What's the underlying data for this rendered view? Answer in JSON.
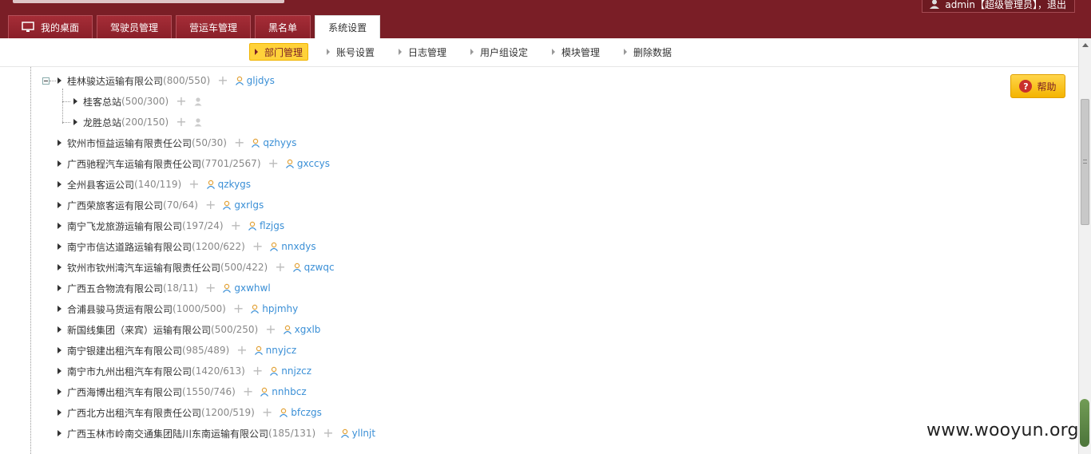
{
  "header": {
    "user_label": "admin【超级管理员】，退出",
    "tabs": [
      {
        "label": "我的桌面"
      },
      {
        "label": "驾驶员管理"
      },
      {
        "label": "营运车管理"
      },
      {
        "label": "黑名单"
      },
      {
        "label": "系统设置"
      }
    ]
  },
  "subnav": [
    {
      "label": "部门管理"
    },
    {
      "label": "账号设置"
    },
    {
      "label": "日志管理"
    },
    {
      "label": "用户组设定"
    },
    {
      "label": "模块管理"
    },
    {
      "label": "删除数据"
    }
  ],
  "help_label": "帮助",
  "tree": {
    "root": {
      "name": "桂林骏达运输有限公司",
      "count": "(800/550)",
      "account": "gljdys"
    },
    "children": [
      {
        "name": "桂客总站",
        "count": "(500/300)"
      },
      {
        "name": "龙胜总站",
        "count": "(200/150)"
      }
    ],
    "companies": [
      {
        "name": "钦州市恒益运输有限责任公司",
        "count": "(50/30)",
        "account": "qzhyys"
      },
      {
        "name": "广西驰程汽车运输有限责任公司",
        "count": "(7701/2567)",
        "account": "gxccys"
      },
      {
        "name": "全州县客运公司",
        "count": " (140/119)",
        "account": "qzkygs"
      },
      {
        "name": "广西荣旅客运有限公司",
        "count": "(70/64)",
        "account": "gxrlgs"
      },
      {
        "name": "南宁飞龙旅游运输有限公司",
        "count": "(197/24)",
        "account": "flzjgs"
      },
      {
        "name": "南宁市信达道路运输有限公司",
        "count": " (1200/622)",
        "account": "nnxdys"
      },
      {
        "name": "钦州市钦州湾汽车运输有限责任公司",
        "count": " (500/422)",
        "account": "qzwqc"
      },
      {
        "name": "广西五合物流有限公司",
        "count": " (18/11)",
        "account": "gxwhwl"
      },
      {
        "name": "合浦县骏马货运有限公司",
        "count": " (1000/500)",
        "account": "hpjmhy"
      },
      {
        "name": "新国线集团（来宾）运输有限公司",
        "count": "(500/250)",
        "account": "xgxlb"
      },
      {
        "name": "南宁银建出租汽车有限公司",
        "count": " (985/489)",
        "account": "nnyjcz"
      },
      {
        "name": "南宁市九州出租汽车有限公司",
        "count": " (1420/613)",
        "account": "nnjzcz"
      },
      {
        "name": "广西海博出租汽车有限公司",
        "count": "(1550/746)",
        "account": "nnhbcz"
      },
      {
        "name": "广西北方出租汽车有限责任公司",
        "count": " (1200/519)",
        "account": "bfczgs"
      },
      {
        "name": "广西玉林市岭南交通集团陆川东南运输有限公司",
        "count": " (185/131)",
        "account": "yllnjt"
      }
    ]
  },
  "watermark": "www.wooyun.org"
}
